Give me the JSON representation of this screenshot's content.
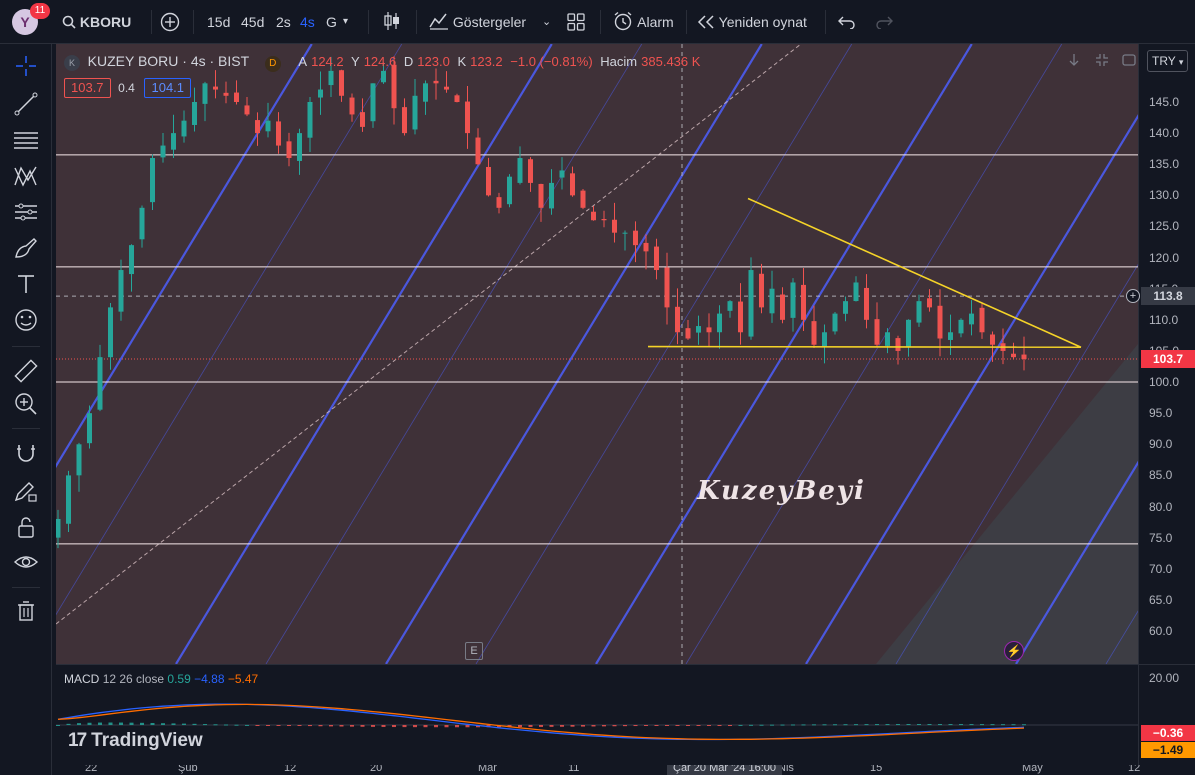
{
  "header": {
    "avatar_letter": "Y",
    "notifications": "11",
    "symbol": "KBORU",
    "intervals": [
      "15d",
      "45d",
      "2s",
      "4s",
      "G"
    ],
    "active_interval": "4s",
    "indicators_label": "Göstergeler",
    "alarm_label": "Alarm",
    "replay_label": "Yeniden oynat"
  },
  "legend": {
    "title": "KUZEY BORU · 4s · BIST",
    "logo_letter": "K",
    "status_letter": "D",
    "open_label": "A",
    "open": "124.2",
    "high_label": "Y",
    "high": "124.6",
    "low_label": "D",
    "low": "123.0",
    "close_label": "K",
    "close": "123.2",
    "change": "−1.0 (−0.81%)",
    "volume_label": "Hacim",
    "volume": "385.436 K",
    "bid": "103.7",
    "spread": "0.4",
    "ask": "104.1"
  },
  "price_axis": {
    "currency": "TRY",
    "ticks": [
      "145.0",
      "140.0",
      "135.0",
      "130.0",
      "125.0",
      "120.0",
      "115.0",
      "110.0",
      "105.0",
      "100.0",
      "95.0",
      "90.0",
      "85.0",
      "80.0",
      "75.0",
      "70.0",
      "65.0",
      "60.0"
    ],
    "crosshair_label": "113.8",
    "last_label": "103.7"
  },
  "macd": {
    "name": "MACD",
    "params": "12 26 close",
    "hist": "0.59",
    "macd": "−4.88",
    "signal": "−5.47",
    "axis_top": "20.00",
    "label_a": "−0.36",
    "label_b": "−1.49"
  },
  "time_axis": {
    "ticks": [
      "22",
      "Şub",
      "12",
      "20",
      "Mar",
      "11",
      "Nis",
      "15",
      "May",
      "12"
    ],
    "crosshair": "Çar 20 Mar '24   16:00"
  },
  "watermark": "KuzeyBeyi",
  "brand": "TradingView",
  "e_marker": "E",
  "colors": {
    "up": "#26a69a",
    "down": "#ef5350",
    "channel": "#3d5afe",
    "triangle": "#f5d328",
    "hline": "#f6e8ea",
    "macd_line": "#2962ff",
    "signal_line": "#ff6d00"
  },
  "chart_data": {
    "type": "candlestick",
    "ylim": [
      55,
      150
    ],
    "horizontal_levels": [
      136.5,
      118.5,
      100.0,
      74.0
    ],
    "crosshair_price": 113.8,
    "last_price": 103.7,
    "triangle": {
      "upper": [
        [
          129.5
        ],
        [
          105.5
        ]
      ],
      "lower": [
        [
          105.6
        ],
        [
          105.5
        ]
      ]
    },
    "closes": [
      78,
      85,
      90,
      95,
      104,
      112,
      118,
      122,
      128,
      136,
      138,
      140,
      142,
      145,
      148,
      147,
      146,
      145,
      143,
      140,
      142,
      138,
      136,
      140,
      145,
      147,
      150,
      146,
      143,
      141,
      148,
      150,
      144,
      140,
      146,
      148,
      148,
      147,
      145,
      140,
      135,
      130,
      128,
      133,
      136,
      132,
      128,
      132,
      134,
      130,
      128,
      126,
      126,
      124,
      124,
      122,
      121,
      118,
      112,
      108,
      107,
      109,
      108,
      111,
      113,
      108,
      118,
      112,
      115,
      110,
      116,
      110,
      106,
      108,
      111,
      113,
      116,
      110,
      106,
      108,
      105,
      110,
      113,
      112,
      107,
      108,
      110,
      111,
      108,
      106,
      105,
      104,
      103.7
    ]
  }
}
